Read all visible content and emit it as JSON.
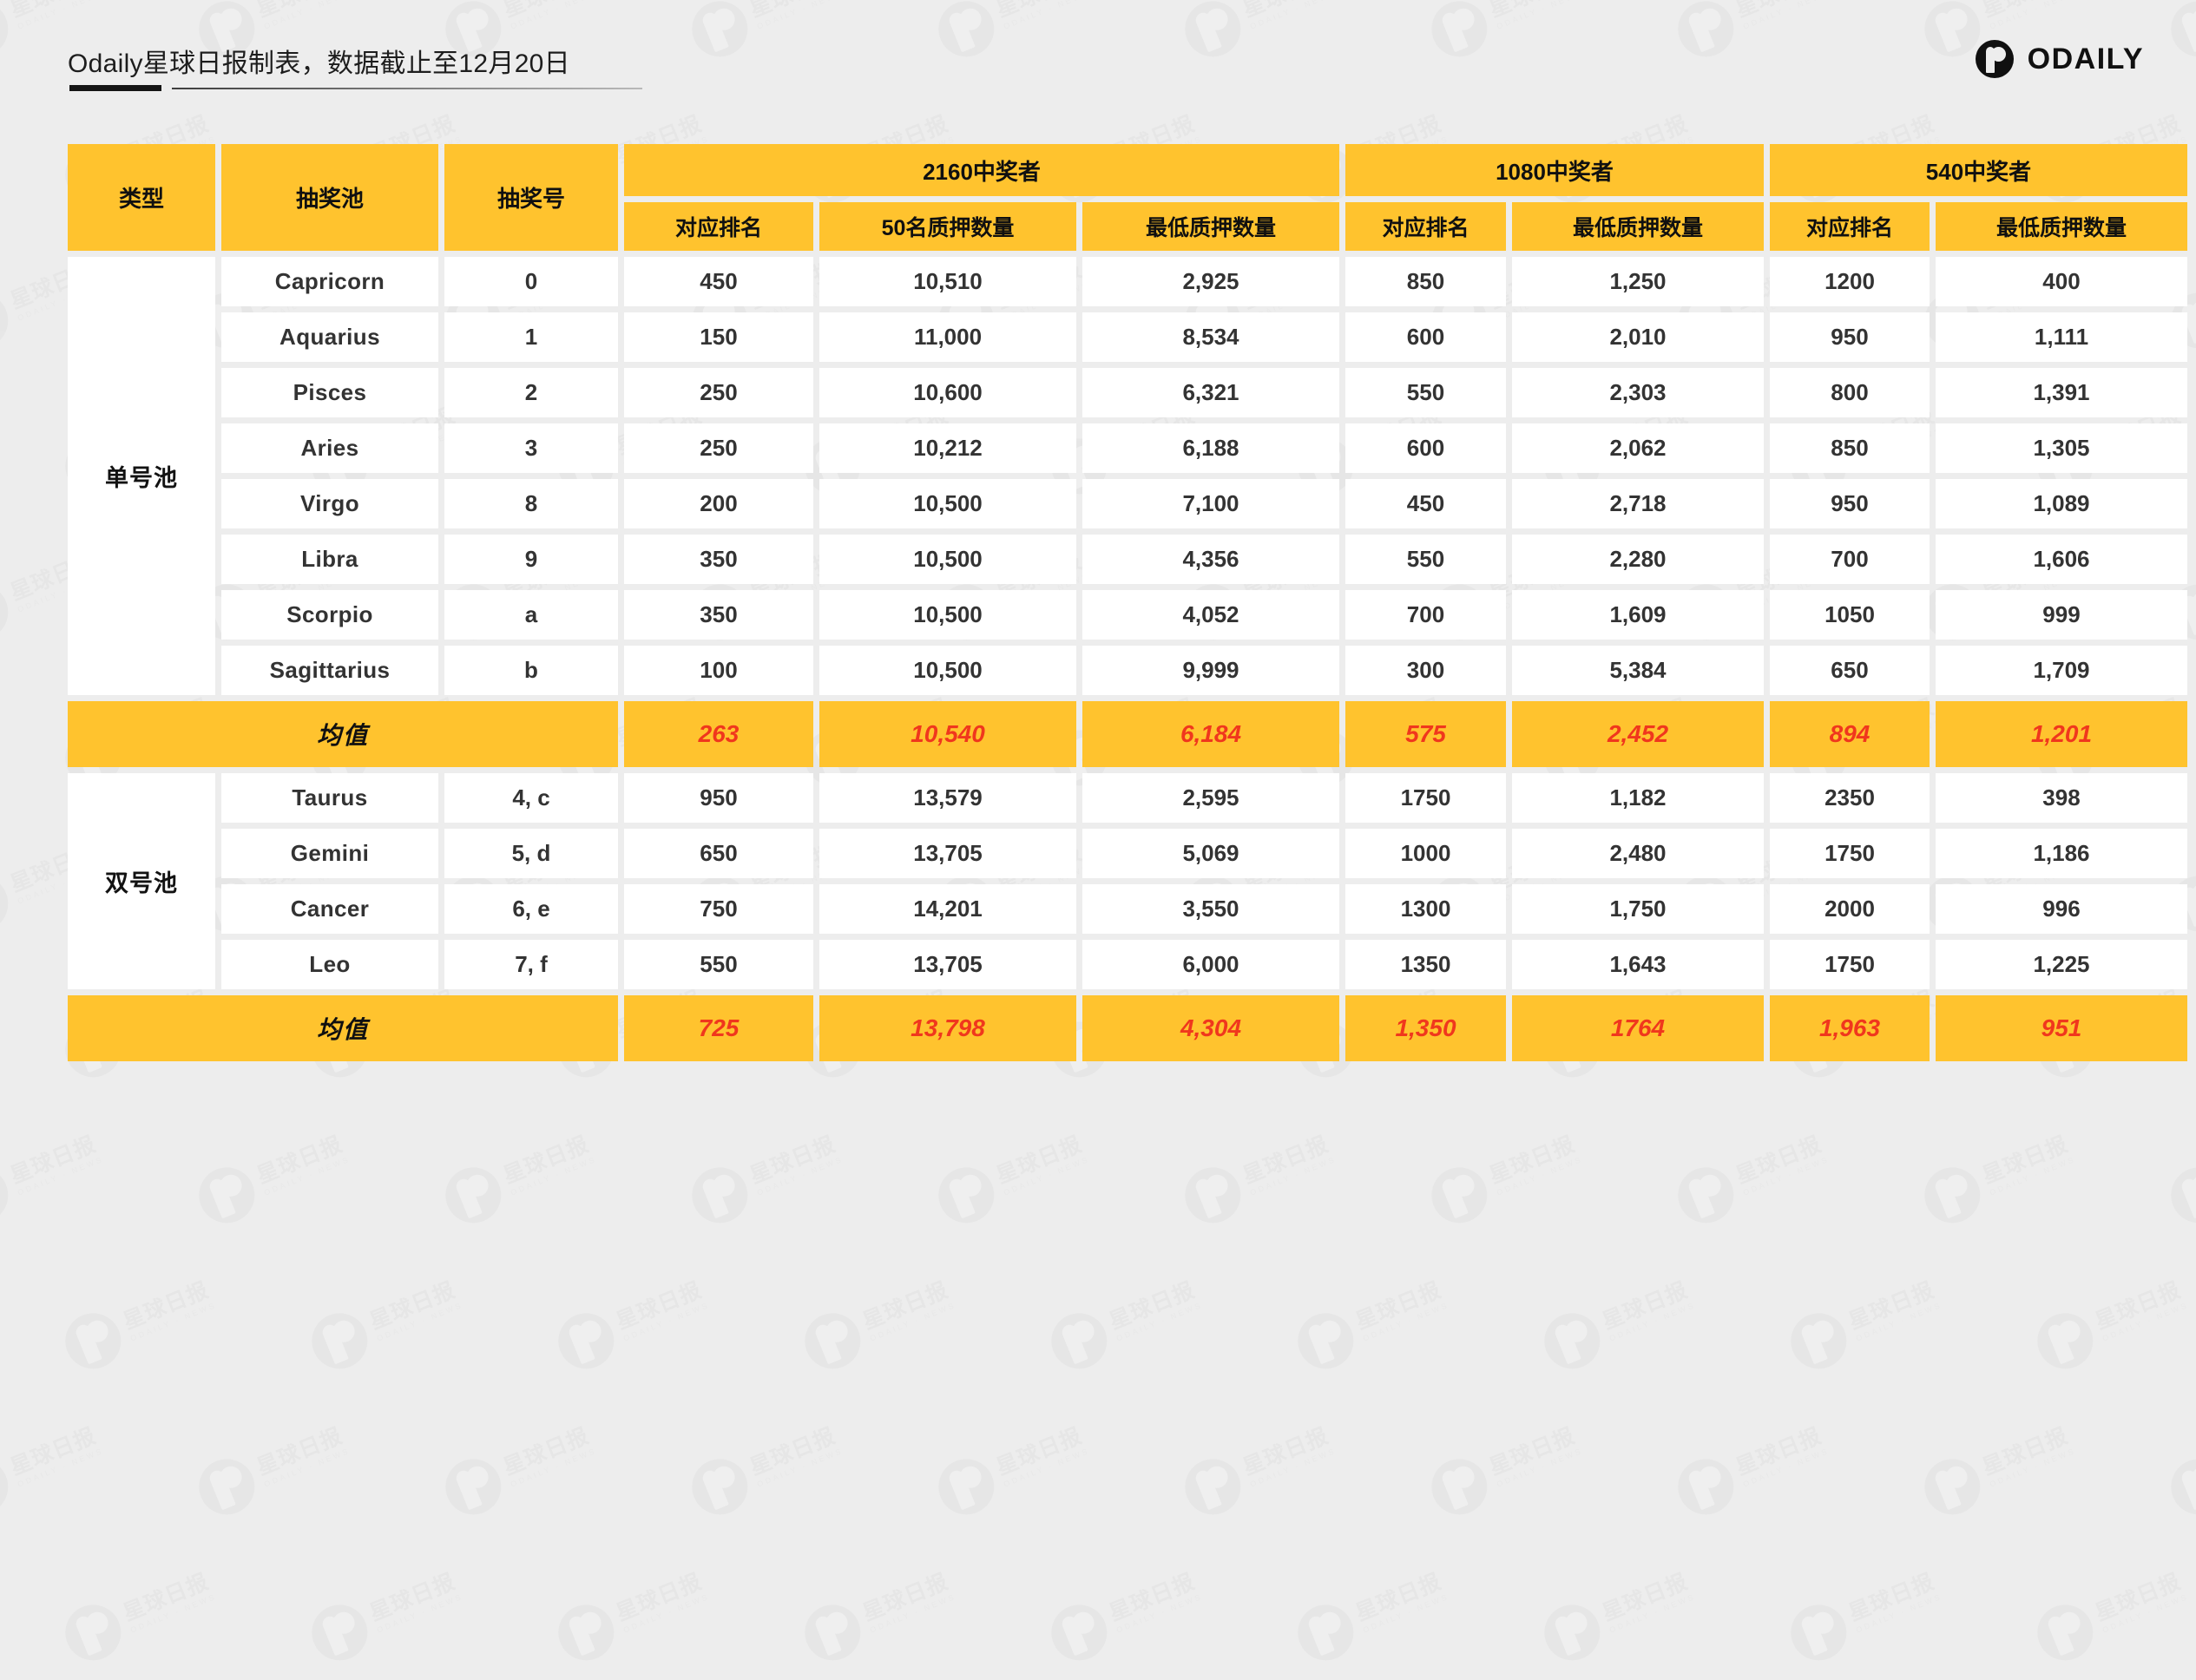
{
  "header": {
    "title": "Odaily星球日报制表，数据截止至12月20日",
    "brand": "ODAILY",
    "brand_icon": "odaily-logo-icon"
  },
  "table": {
    "columns": {
      "type": "类型",
      "pool": "抽奖池",
      "draw_no": "抽奖号",
      "rank": "对应排名",
      "stake_50": "50名质押数量",
      "min_stake": "最低质押数量"
    },
    "groups": [
      {
        "label": "2160中奖者",
        "subs": [
          "对应排名",
          "50名质押数量",
          "最低质押数量"
        ]
      },
      {
        "label": "1080中奖者",
        "subs": [
          "对应排名",
          "最低质押数量"
        ]
      },
      {
        "label": "540中奖者",
        "subs": [
          "对应排名",
          "最低质押数量"
        ]
      }
    ],
    "average_label": "均值",
    "sections": [
      {
        "type_label": "单号池",
        "rows": [
          {
            "pool": "Capricorn",
            "no": "0",
            "r2160": "450",
            "s50": "10,510",
            "m2160": "2,925",
            "r1080": "850",
            "m1080": "1,250",
            "r540": "1200",
            "m540": "400"
          },
          {
            "pool": "Aquarius",
            "no": "1",
            "r2160": "150",
            "s50": "11,000",
            "m2160": "8,534",
            "r1080": "600",
            "m1080": "2,010",
            "r540": "950",
            "m540": "1,111"
          },
          {
            "pool": "Pisces",
            "no": "2",
            "r2160": "250",
            "s50": "10,600",
            "m2160": "6,321",
            "r1080": "550",
            "m1080": "2,303",
            "r540": "800",
            "m540": "1,391"
          },
          {
            "pool": "Aries",
            "no": "3",
            "r2160": "250",
            "s50": "10,212",
            "m2160": "6,188",
            "r1080": "600",
            "m1080": "2,062",
            "r540": "850",
            "m540": "1,305"
          },
          {
            "pool": "Virgo",
            "no": "8",
            "r2160": "200",
            "s50": "10,500",
            "m2160": "7,100",
            "r1080": "450",
            "m1080": "2,718",
            "r540": "950",
            "m540": "1,089"
          },
          {
            "pool": "Libra",
            "no": "9",
            "r2160": "350",
            "s50": "10,500",
            "m2160": "4,356",
            "r1080": "550",
            "m1080": "2,280",
            "r540": "700",
            "m540": "1,606"
          },
          {
            "pool": "Scorpio",
            "no": "a",
            "r2160": "350",
            "s50": "10,500",
            "m2160": "4,052",
            "r1080": "700",
            "m1080": "1,609",
            "r540": "1050",
            "m540": "999"
          },
          {
            "pool": "Sagittarius",
            "no": "b",
            "r2160": "100",
            "s50": "10,500",
            "m2160": "9,999",
            "r1080": "300",
            "m1080": "5,384",
            "r540": "650",
            "m540": "1,709"
          }
        ],
        "average": {
          "r2160": "263",
          "s50": "10,540",
          "m2160": "6,184",
          "r1080": "575",
          "m1080": "2,452",
          "r540": "894",
          "m540": "1,201"
        }
      },
      {
        "type_label": "双号池",
        "rows": [
          {
            "pool": "Taurus",
            "no": "4, c",
            "r2160": "950",
            "s50": "13,579",
            "m2160": "2,595",
            "r1080": "1750",
            "m1080": "1,182",
            "r540": "2350",
            "m540": "398"
          },
          {
            "pool": "Gemini",
            "no": "5, d",
            "r2160": "650",
            "s50": "13,705",
            "m2160": "5,069",
            "r1080": "1000",
            "m1080": "2,480",
            "r540": "1750",
            "m540": "1,186"
          },
          {
            "pool": "Cancer",
            "no": "6, e",
            "r2160": "750",
            "s50": "14,201",
            "m2160": "3,550",
            "r1080": "1300",
            "m1080": "1,750",
            "r540": "2000",
            "m540": "996"
          },
          {
            "pool": "Leo",
            "no": "7, f",
            "r2160": "550",
            "s50": "13,705",
            "m2160": "6,000",
            "r1080": "1350",
            "m1080": "1,643",
            "r540": "1750",
            "m540": "1,225"
          }
        ],
        "average": {
          "r2160": "725",
          "s50": "13,798",
          "m2160": "4,304",
          "r1080": "1,350",
          "m1080": "1764",
          "r540": "1,963",
          "m540": "951"
        }
      }
    ]
  },
  "theme": {
    "accent_yellow": "#ffc32e",
    "accent_red": "#f0371d",
    "background": "#ededed",
    "cell_white": "#ffffff",
    "text_dark": "#2b2b2b"
  },
  "watermark": {
    "cn": "星球日报",
    "en": "ODAILY · NEWS"
  }
}
